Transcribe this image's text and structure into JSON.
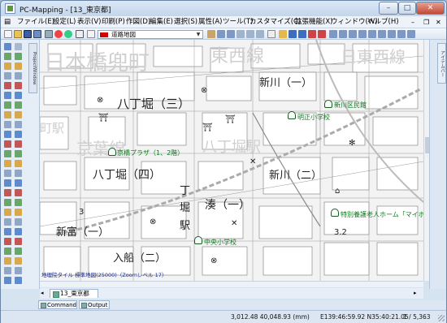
{
  "window": {
    "title": "PC-Mapping - [13_東京都]",
    "min": "–",
    "max": "□",
    "close": "✕"
  },
  "menu": [
    {
      "label": "ファイル(E)"
    },
    {
      "label": "設定(L)"
    },
    {
      "label": "表示(V)"
    },
    {
      "label": "印刷(P)"
    },
    {
      "label": "作図(D)"
    },
    {
      "label": "編集(E)"
    },
    {
      "label": "選択(S)"
    },
    {
      "label": "属性(A)"
    },
    {
      "label": "ツール(T)"
    },
    {
      "label": "カスタマイズ(C)"
    },
    {
      "label": "拡張機能(X)"
    },
    {
      "label": "ウィンドウ(W)"
    },
    {
      "label": "ヘルプ(H)"
    }
  ],
  "toolbar": {
    "layer_combo_value": "道路地図"
  },
  "left_panel": {
    "vertical_tab": "ProjectWindow"
  },
  "right_panel": {
    "vertical_tab": "アイテムバー"
  },
  "map": {
    "big_labels": [
      "日本橋兜町",
      "東西線",
      "京葉線",
      "八丁堀駅",
      "町駅",
      "日東西線"
    ],
    "place_labels": [
      "新川（一）",
      "八丁堀（三）",
      "新川（二）",
      "八丁堀（四）",
      "湊（一）",
      "新富（一）",
      "入船（二）"
    ],
    "small_labels": [
      "丁",
      "堀",
      "駅",
      "3",
      "3.2"
    ],
    "poi": [
      "新川区民館",
      "明正小学校",
      "京橋プラザ（1、2階）",
      "特別養護老人ホーム「マイホー",
      "中央小学校"
    ],
    "attribution": "地理院タイル 標準地図(25000)（Zoomレベル 17）"
  },
  "doc_tab": {
    "label": "13_東京都"
  },
  "bottom_tabs": [
    {
      "label": "Command"
    },
    {
      "label": "Output"
    }
  ],
  "status": {
    "coords": "3,012.48 40,048.93 (mm)",
    "latlon": "E139:46:59.92 N35:40:21.05",
    "page": "1 / 5,363"
  }
}
